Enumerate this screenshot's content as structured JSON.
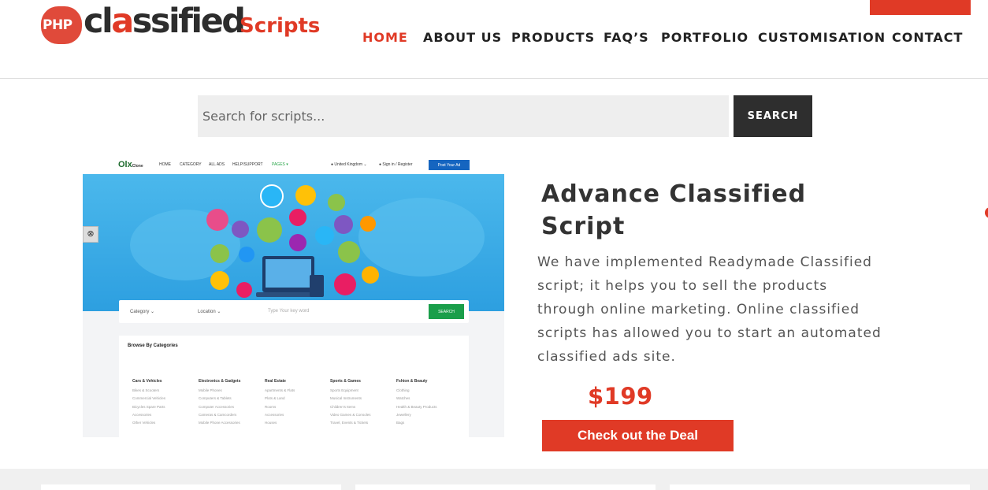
{
  "brand": {
    "badge": "PHP",
    "word_prefix": "cl",
    "word_o": "a",
    "word_suffix": "ssified",
    "scripts": "Scripts"
  },
  "nav": {
    "items": [
      {
        "label": "HOME",
        "active": true
      },
      {
        "label": "ABOUT US",
        "active": false
      },
      {
        "label": "PRODUCTS",
        "active": false
      },
      {
        "label": "FAQ’S",
        "active": false
      },
      {
        "label": "PORTFOLIO",
        "active": false
      },
      {
        "label": "CUSTOMISATION",
        "active": false
      },
      {
        "label": "CONTACT",
        "active": false
      }
    ]
  },
  "search": {
    "placeholder": "Search for scripts...",
    "button_label": "SEARCH"
  },
  "preview": {
    "logo": "Olx",
    "logo_suffix": "Clone",
    "nav": [
      "HOME",
      "CATEGORY",
      "ALL ADS",
      "HELP/SUPPORT",
      "PAGES ▾"
    ],
    "region": "● United Kingdom ⌄",
    "signin": "● Sign in / Register",
    "post_ad": "Post Your Ad",
    "search": {
      "category": "Category ⌄",
      "location": "Location ⌄",
      "keyword": "Type Your key word",
      "button": "SEARCH"
    },
    "browse_title": "Browse By Categories",
    "categories": [
      {
        "name": "Cars & Vehicles",
        "subs": [
          "Bikes & Scooters",
          "Commercial Vehicles",
          "Bicycles Spare Parts",
          "Accessories",
          "Other Vehicles"
        ]
      },
      {
        "name": "Electronics & Gadgets",
        "subs": [
          "Mobile Phones",
          "Computers & Tablets",
          "Computer Accessories",
          "Cameras & Camcorders",
          "Mobile Phone Accessories"
        ]
      },
      {
        "name": "Real Estate",
        "subs": [
          "Apartments & Flats",
          "Plots & Land",
          "Rooms",
          "Accessories",
          "Houses"
        ]
      },
      {
        "name": "Sports & Games",
        "subs": [
          "Sports Equipment",
          "Musical Instruments",
          "Children's Items",
          "Video Games & Consoles",
          "Travel, Events & Tickets"
        ]
      },
      {
        "name": "Fshion & Beauty",
        "subs": [
          "Clothing",
          "Watches",
          "Health & Beauty Products",
          "Jewellery",
          "Bags"
        ]
      }
    ]
  },
  "product": {
    "title": "Advance Classified Script",
    "description": "We have implemented Readymade Classified script; it helps you to sell the products through online marketing. Online classified scripts has allowed you to start an automated classified ads site.",
    "price": "$199",
    "cta": "Check out the Deal"
  },
  "colors": {
    "accent": "#e03a26",
    "dark": "#2e2e2e",
    "search_bg": "#eeeeee"
  }
}
